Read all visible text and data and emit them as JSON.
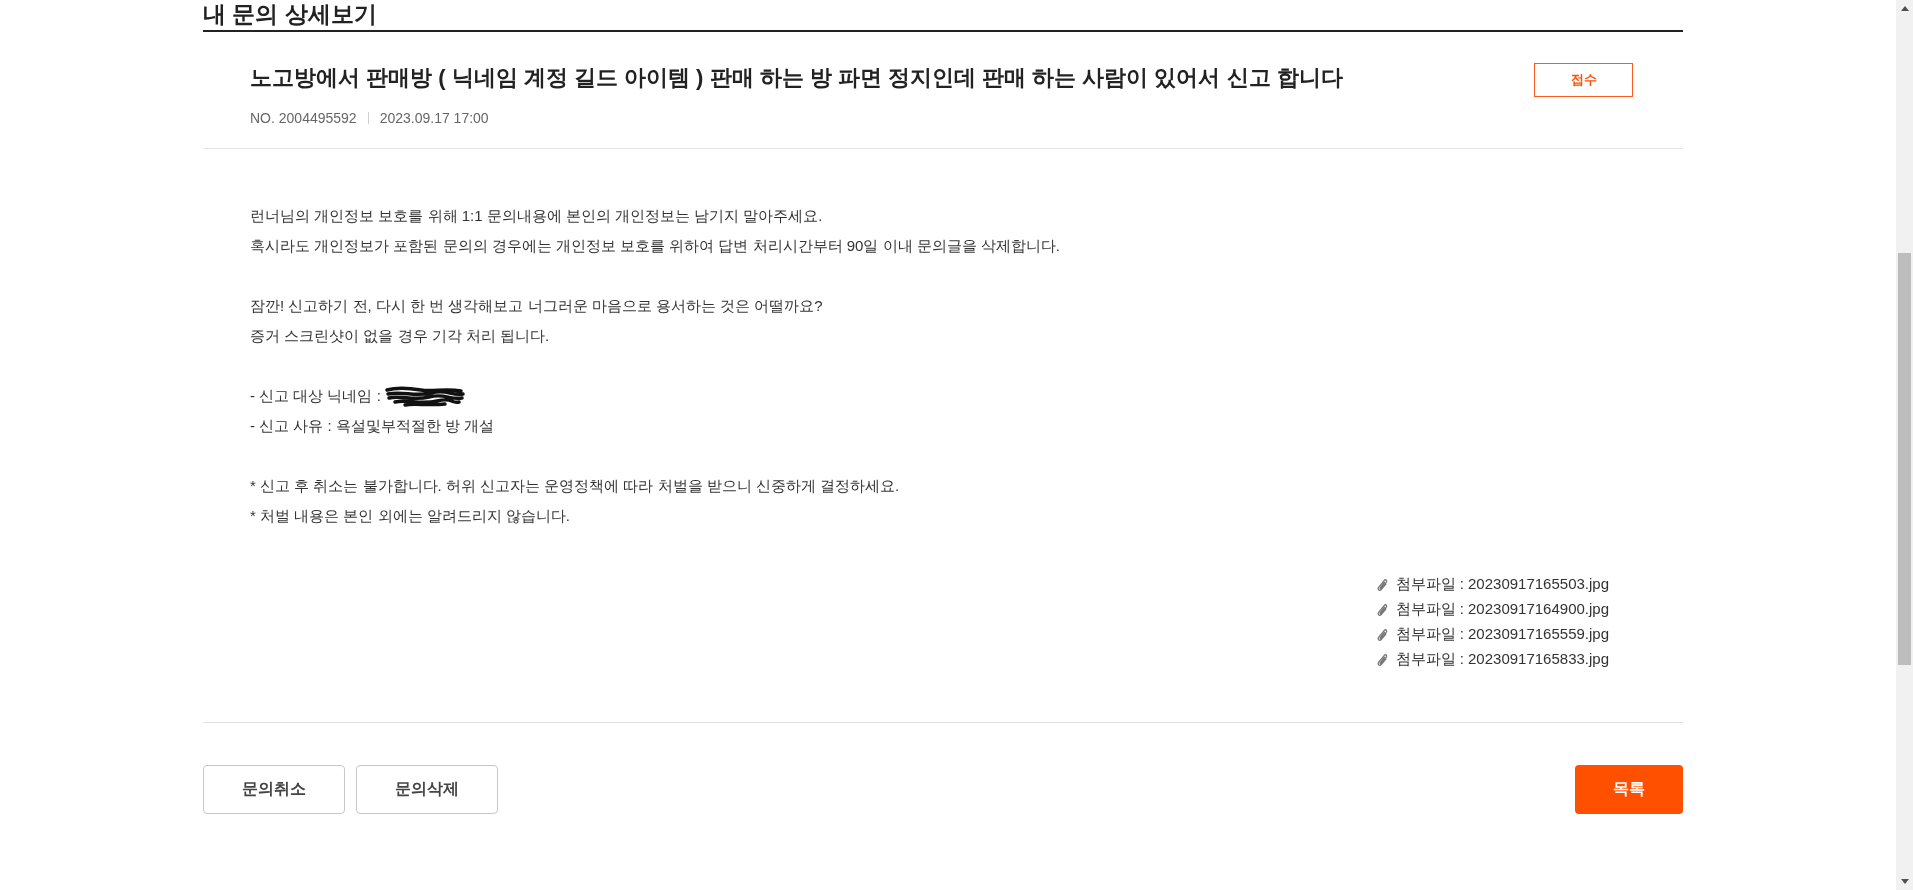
{
  "page_heading": "내 문의 상세보기",
  "inquiry": {
    "title": "노고방에서 판매방 ( 닉네임 계정 길드 아이템 ) 판매 하는 방 파면 정지인데 판매 하는 사람이 있어서 신고 합니다",
    "status": "접수",
    "number": "NO. 2004495592",
    "date": "2023.09.17 17:00"
  },
  "body": [
    [
      {
        "text": "런너님의 개인정보 보호를 위해 1:1 문의내용에 본인의 개인정보는 남기지 말아주세요.",
        "redacted": false
      },
      {
        "text": "혹시라도 개인정보가 포함된 문의의 경우에는 개인정보 보호를 위하여 답변 처리시간부터 90일 이내 문의글을 삭제합니다.",
        "redacted": false
      }
    ],
    [
      {
        "text": "잠깐! 신고하기 전, 다시 한 번 생각해보고 너그러운 마음으로 용서하는 것은 어떨까요?",
        "redacted": false
      },
      {
        "text": "증거 스크린샷이 없을 경우 기각 처리 됩니다.",
        "redacted": false
      }
    ],
    [
      {
        "text": "- 신고 대상 닉네임 :",
        "redacted": true
      },
      {
        "text": "- 신고 사유 : 욕설및부적절한 방 개설",
        "redacted": false
      }
    ],
    [
      {
        "text": "* 신고 후 취소는 불가합니다. 허위 신고자는 운영정책에 따라 처벌을 받으니 신중하게 결정하세요.",
        "redacted": false
      },
      {
        "text": "* 처벌 내용은 본인 외에는 알려드리지 않습니다.",
        "redacted": false
      }
    ]
  ],
  "attachments": [
    "첨부파일 : 20230917165503.jpg",
    "첨부파일 : 20230917164900.jpg",
    "첨부파일 : 20230917165559.jpg",
    "첨부파일 : 20230917165833.jpg"
  ],
  "buttons": [
    {
      "kind": "cancel",
      "label": "문의취소"
    },
    {
      "kind": "delete",
      "label": "문의삭제"
    },
    {
      "kind": "list",
      "label": "목록"
    }
  ]
}
